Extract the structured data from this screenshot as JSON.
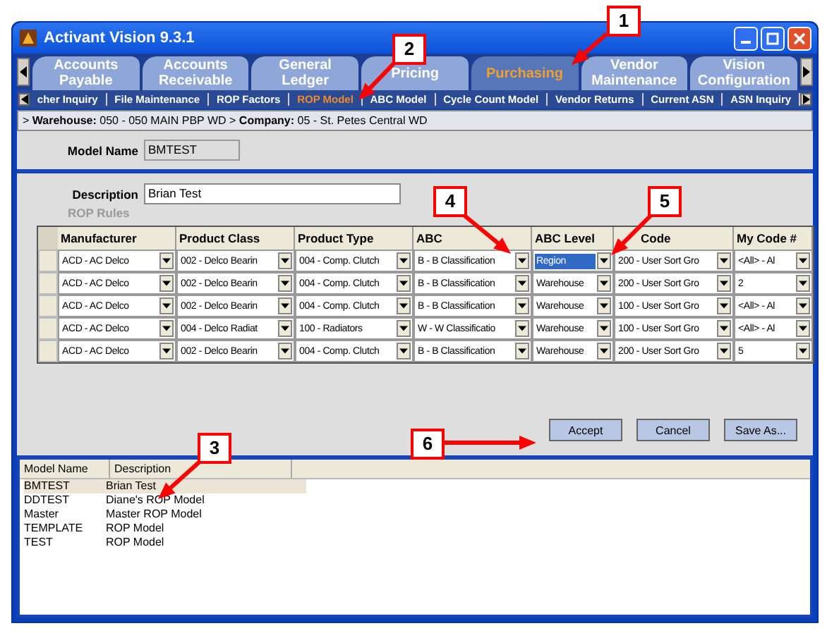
{
  "window": {
    "title": "Activant Vision 9.3.1"
  },
  "tabs": [
    {
      "label": "Accounts Payable",
      "selected": false
    },
    {
      "label": "Accounts Receivable",
      "selected": false
    },
    {
      "label": "General Ledger",
      "selected": false
    },
    {
      "label": "Pricing",
      "selected": false
    },
    {
      "label": "Purchasing",
      "selected": true
    },
    {
      "label": "Vendor Maintenance",
      "selected": false
    },
    {
      "label": "Vision Configuration",
      "selected": false
    }
  ],
  "subnav": [
    {
      "label": "cher Inquiry",
      "selected": false
    },
    {
      "label": "File Maintenance",
      "selected": false
    },
    {
      "label": "ROP Factors",
      "selected": false
    },
    {
      "label": "ROP Model",
      "selected": true
    },
    {
      "label": "ABC Model",
      "selected": false
    },
    {
      "label": "Cycle Count Model",
      "selected": false
    },
    {
      "label": "Vendor Returns",
      "selected": false
    },
    {
      "label": "Current ASN",
      "selected": false
    },
    {
      "label": "ASN Inquiry",
      "selected": false
    }
  ],
  "breadcrumb": "> **Warehouse:** 050 - 050 MAIN PBP WD > **Company:** 05 - St. Petes Central WD",
  "model_name": {
    "label": "Model Name",
    "value": "BMTEST"
  },
  "description": {
    "label": "Description",
    "value": "Brian Test"
  },
  "rules": {
    "title": "ROP Rules",
    "columns": [
      "Manufacturer",
      "Product Class",
      "Product Type",
      "ABC",
      "ABC Level",
      "Code",
      "My Code #"
    ],
    "rows": [
      {
        "cells": [
          {
            "value": "ACD - AC Delco",
            "selected": false
          },
          {
            "value": "002 - Delco Bearin",
            "selected": false
          },
          {
            "value": "004 - Comp. Clutch",
            "selected": false
          },
          {
            "value": "B - B Classification",
            "selected": false
          },
          {
            "value": "Region",
            "selected": true
          },
          {
            "value": "200 - User Sort Gro",
            "selected": false
          },
          {
            "value": "<All> - Al",
            "selected": false
          }
        ]
      },
      {
        "cells": [
          {
            "value": "ACD - AC Delco",
            "selected": false
          },
          {
            "value": "002 - Delco Bearin",
            "selected": false
          },
          {
            "value": "004 - Comp. Clutch",
            "selected": false
          },
          {
            "value": "B - B Classification",
            "selected": false
          },
          {
            "value": "Warehouse",
            "selected": false
          },
          {
            "value": "200 - User Sort Gro",
            "selected": false
          },
          {
            "value": "2",
            "selected": false
          }
        ]
      },
      {
        "cells": [
          {
            "value": "ACD - AC Delco",
            "selected": false
          },
          {
            "value": "002 - Delco Bearin",
            "selected": false
          },
          {
            "value": "004 - Comp. Clutch",
            "selected": false
          },
          {
            "value": "B - B Classification",
            "selected": false
          },
          {
            "value": "Warehouse",
            "selected": false
          },
          {
            "value": "100 - User Sort Gro",
            "selected": false
          },
          {
            "value": "<All> - Al",
            "selected": false
          }
        ]
      },
      {
        "cells": [
          {
            "value": "ACD - AC Delco",
            "selected": false
          },
          {
            "value": "004 - Delco Radiat",
            "selected": false
          },
          {
            "value": "100 - Radiators",
            "selected": false
          },
          {
            "value": "W - W Classificatio",
            "selected": false
          },
          {
            "value": "Warehouse",
            "selected": false
          },
          {
            "value": "100 - User Sort Gro",
            "selected": false
          },
          {
            "value": "<All> - Al",
            "selected": false
          }
        ]
      },
      {
        "cells": [
          {
            "value": "ACD - AC Delco",
            "selected": false
          },
          {
            "value": "002 - Delco Bearin",
            "selected": false
          },
          {
            "value": "004 - Comp. Clutch",
            "selected": false
          },
          {
            "value": "B - B Classification",
            "selected": false
          },
          {
            "value": "Warehouse",
            "selected": false
          },
          {
            "value": "200 - User Sort Gro",
            "selected": false
          },
          {
            "value": "5",
            "selected": false
          }
        ]
      }
    ]
  },
  "buttons": [
    "Accept",
    "Cancel",
    "Save As..."
  ],
  "models": {
    "columns": [
      "Model Name",
      "Description"
    ],
    "rows": [
      {
        "name": "BMTEST",
        "description": "Brian Test",
        "selected": true
      },
      {
        "name": "DDTEST",
        "description": "Diane's ROP Model",
        "selected": false
      },
      {
        "name": "Master",
        "description": "Master ROP Model",
        "selected": false
      },
      {
        "name": "TEMPLATE",
        "description": "ROP Model",
        "selected": false
      },
      {
        "name": "TEST",
        "description": "ROP Model",
        "selected": false
      }
    ]
  },
  "callouts": [
    "1",
    "2",
    "3",
    "4",
    "5",
    "6"
  ]
}
